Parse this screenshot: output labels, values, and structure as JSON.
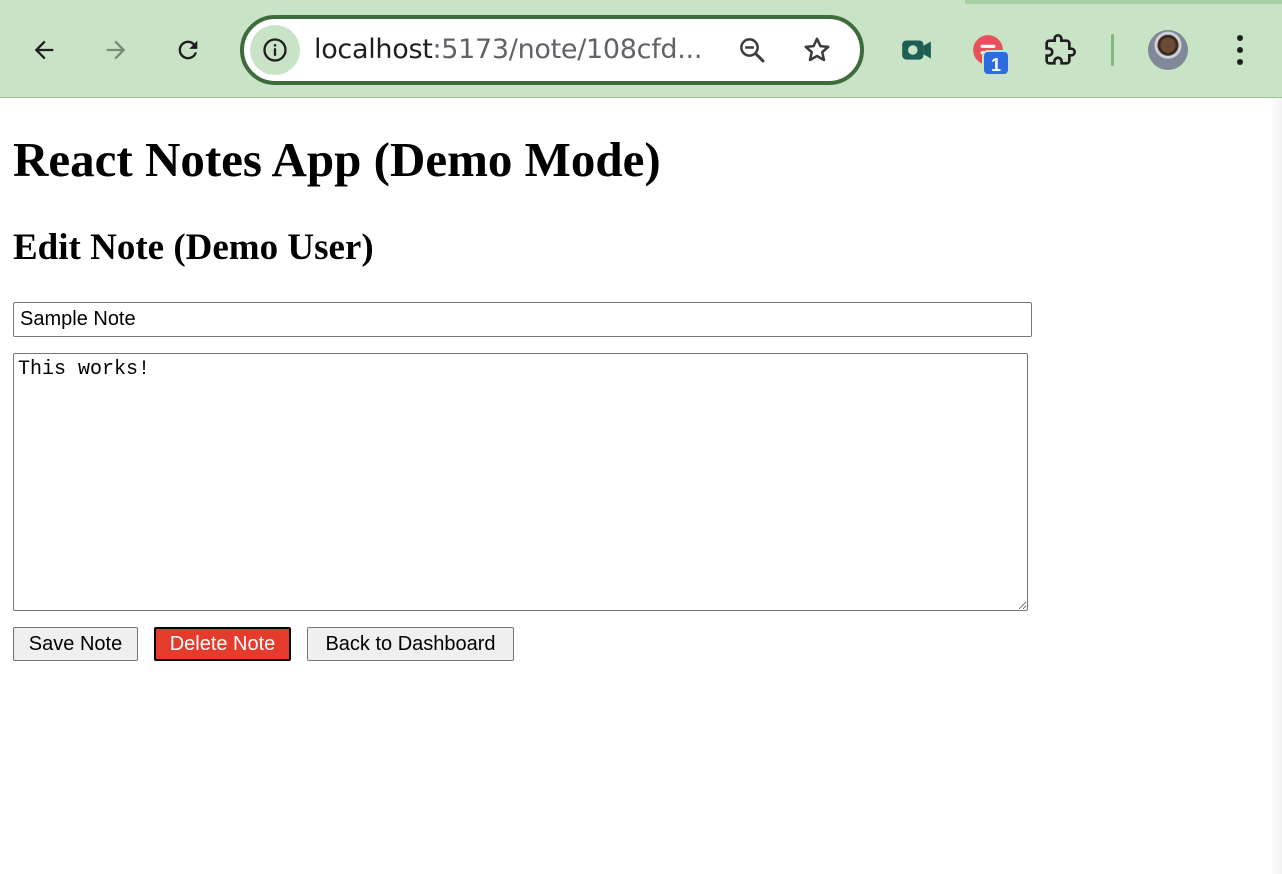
{
  "browser": {
    "url_host": "localhost",
    "url_path": ":5173/note/108cfd...",
    "extension_badge": "1"
  },
  "page": {
    "app_title": "React Notes App (Demo Mode)",
    "edit_heading": "Edit Note (Demo User)",
    "title_value": "Sample Note",
    "content_value": "This works!",
    "buttons": {
      "save": "Save Note",
      "delete": "Delete Note",
      "back": "Back to Dashboard"
    }
  },
  "colors": {
    "toolbar_bg": "#c9e3c6",
    "omnibox_border": "#3d6b3b",
    "delete_button": "#e53b2c"
  },
  "icons": [
    "back-arrow-icon",
    "forward-arrow-icon",
    "reload-icon",
    "site-info-icon",
    "zoom-icon",
    "bookmark-star-icon",
    "screen-recorder-icon",
    "extension-badge-icon",
    "extensions-puzzle-icon",
    "profile-avatar",
    "menu-dots-icon"
  ]
}
